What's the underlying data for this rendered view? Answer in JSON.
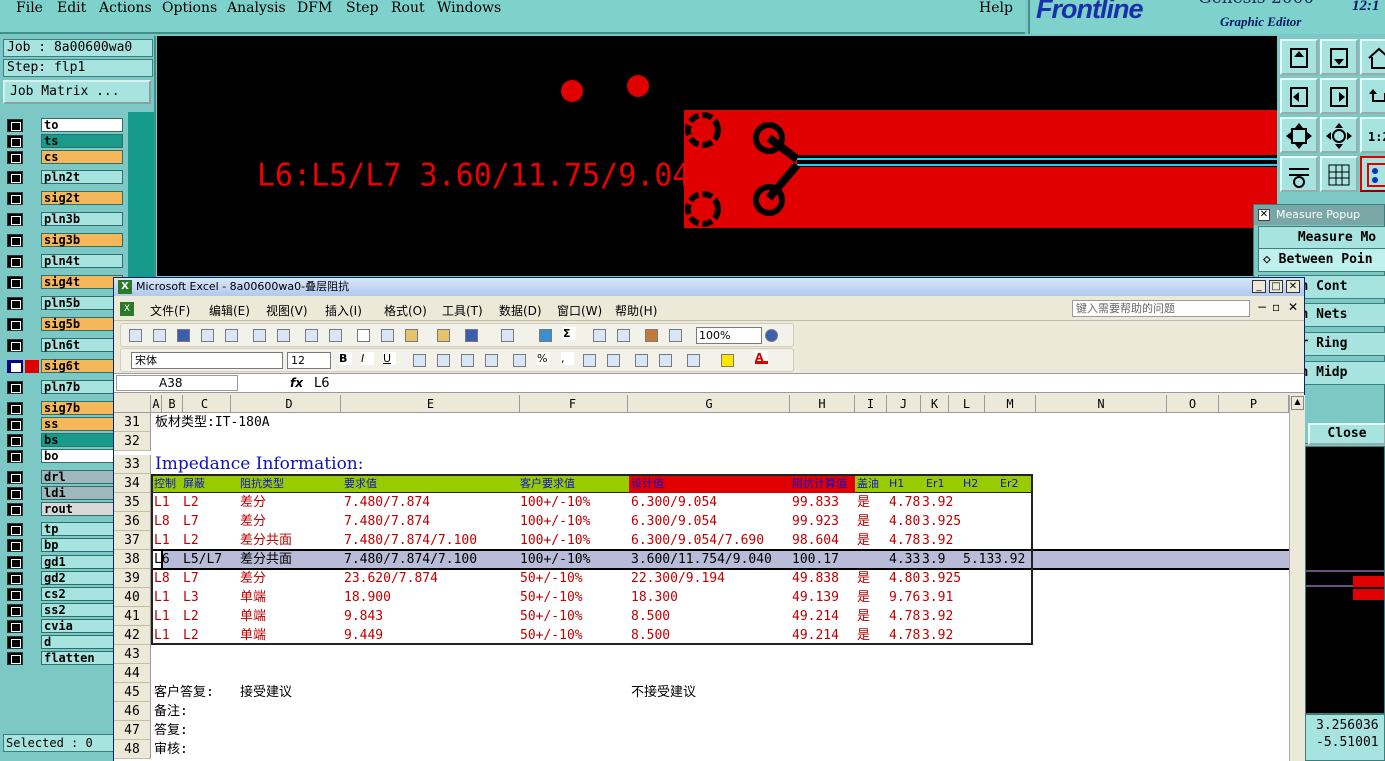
{
  "menubar": {
    "items": [
      "File",
      "Edit",
      "Actions",
      "Options",
      "Analysis",
      "DFM",
      "Step",
      "Rout",
      "Windows"
    ],
    "help": "Help"
  },
  "brand": {
    "logo": "Frontline",
    "product": "Genesis 2000",
    "subtitle": "Graphic Editor",
    "clock": "12:1"
  },
  "left": {
    "job": "Job : 8a00600wa0",
    "step": "Step: flp1",
    "job_matrix": "Job Matrix ...",
    "selected": "Selected : 0",
    "layers": [
      {
        "name": "to",
        "color": "#ffffff",
        "swatch": ""
      },
      {
        "name": "ts",
        "color": "#1a9a8a",
        "swatch": ""
      },
      {
        "name": "cs",
        "color": "#f4b85a",
        "swatch": ""
      },
      {
        "name": "pln2t",
        "color": "#a7e3df",
        "swatch": ""
      },
      {
        "name": "sig2t",
        "color": "#f4b85a",
        "swatch": ""
      },
      {
        "name": "pln3b",
        "color": "#a7e3df",
        "swatch": ""
      },
      {
        "name": "sig3b",
        "color": "#f4b85a",
        "swatch": ""
      },
      {
        "name": "pln4t",
        "color": "#a7e3df",
        "swatch": ""
      },
      {
        "name": "sig4t",
        "color": "#f4b85a",
        "swatch": ""
      },
      {
        "name": "pln5b",
        "color": "#a7e3df",
        "swatch": ""
      },
      {
        "name": "sig5b",
        "color": "#f4b85a",
        "swatch": ""
      },
      {
        "name": "pln6t",
        "color": "#a7e3df",
        "swatch": ""
      },
      {
        "name": "sig6t",
        "color": "#f4b85a",
        "swatch": "#e00000",
        "selected": true
      },
      {
        "name": "pln7b",
        "color": "#a7e3df",
        "swatch": ""
      },
      {
        "name": "sig7b",
        "color": "#f4b85a",
        "swatch": ""
      },
      {
        "name": "ss",
        "color": "#f4b85a",
        "swatch": ""
      },
      {
        "name": "bs",
        "color": "#1a9a8a",
        "swatch": ""
      },
      {
        "name": "bo",
        "color": "#ffffff",
        "swatch": ""
      },
      {
        "name": "drl",
        "color": "#9fb8bc",
        "swatch": ""
      },
      {
        "name": "ldi",
        "color": "#9fb8bc",
        "swatch": ""
      },
      {
        "name": "rout",
        "color": "#d8d8d8",
        "swatch": ""
      },
      {
        "name": "tp",
        "color": "#a7e3df",
        "swatch": ""
      },
      {
        "name": "bp",
        "color": "#a7e3df",
        "swatch": ""
      },
      {
        "name": "gd1",
        "color": "#a7e3df",
        "swatch": ""
      },
      {
        "name": "gd2",
        "color": "#a7e3df",
        "swatch": ""
      },
      {
        "name": "cs2",
        "color": "#a7e3df",
        "swatch": ""
      },
      {
        "name": "ss2",
        "color": "#a7e3df",
        "swatch": ""
      },
      {
        "name": "cvia",
        "color": "#a7e3df",
        "swatch": ""
      },
      {
        "name": "d",
        "color": "#a7e3df",
        "swatch": ""
      },
      {
        "name": "flatten",
        "color": "#a7e3df",
        "swatch": ""
      }
    ]
  },
  "canvas": {
    "label": "L6:L5/L7 3.60/11.75/9.04"
  },
  "measure": {
    "title": "Measure Popup",
    "mode": "Measure Mo",
    "options": [
      "Between Poin",
      "ween Cont",
      "ween Nets",
      "ular Ring",
      "ween Midp"
    ],
    "close": "Close",
    "coords": [
      "3.256036",
      "-5.51001"
    ]
  },
  "excel": {
    "title": "Microsoft Excel - 8a00600wa0-叠层阻抗",
    "menu": [
      "文件(F)",
      "编辑(E)",
      "视图(V)",
      "插入(I)",
      "格式(O)",
      "工具(T)",
      "数据(D)",
      "窗口(W)",
      "帮助(H)"
    ],
    "help_placeholder": "键入需要帮助的问题",
    "font": "宋体",
    "size": "12",
    "zoom": "100%",
    "namebox": "A38",
    "fx": "fx",
    "formula": "L6",
    "columns": [
      "A",
      "B",
      "C",
      "D",
      "E",
      "F",
      "G",
      "H",
      "I",
      "J",
      "K",
      "L",
      "M",
      "N",
      "O",
      "P"
    ],
    "row31": "板材类型:IT-180A",
    "heading": "Impedance Information:",
    "headers": {
      "a": "控制",
      "b": "屏蔽",
      "c": "阻抗类型",
      "d": "要求值",
      "e": "客户要求值",
      "f": "设计值",
      "g": "阻抗计算值",
      "h": "盖油",
      "i": "H1",
      "j": "Er1",
      "k": "H2",
      "l": "Er2"
    },
    "rows": [
      {
        "n": "35",
        "a": "L1",
        "b": "L2",
        "c": "差分",
        "d": "7.480/7.874",
        "e": "100+/-10%",
        "f": "6.300/9.054",
        "g": "99.833",
        "h": "是",
        "i": "4.78",
        "j": "3.92",
        "k": "",
        "l": ""
      },
      {
        "n": "36",
        "a": "L8",
        "b": "L7",
        "c": "差分",
        "d": "7.480/7.874",
        "e": "100+/-10%",
        "f": "6.300/9.054",
        "g": "99.923",
        "h": "是",
        "i": "4.80",
        "j": "3.925",
        "k": "",
        "l": ""
      },
      {
        "n": "37",
        "a": "L1",
        "b": "L2",
        "c": "差分共面",
        "d": "7.480/7.874/7.100",
        "e": "100+/-10%",
        "f": "6.300/9.054/7.690",
        "g": "98.604",
        "h": "是",
        "i": "4.78",
        "j": "3.92",
        "k": "",
        "l": ""
      },
      {
        "n": "38",
        "a": "L6",
        "b": "L5/L7",
        "c": "差分共面",
        "d": "7.480/7.874/7.100",
        "e": "100+/-10%",
        "f": "3.600/11.754/9.040",
        "g": "100.17",
        "h": "",
        "i": "4.33",
        "j": "3.9",
        "k": "5.13",
        "l": "3.92",
        "sel": true
      },
      {
        "n": "39",
        "a": "L8",
        "b": "L7",
        "c": "差分",
        "d": "23.620/7.874",
        "e": "50+/-10%",
        "f": "22.300/9.194",
        "g": "49.838",
        "h": "是",
        "i": "4.80",
        "j": "3.925",
        "k": "",
        "l": ""
      },
      {
        "n": "40",
        "a": "L1",
        "b": "L3",
        "c": "单端",
        "d": "18.900",
        "e": "50+/-10%",
        "f": "18.300",
        "g": "49.139",
        "h": "是",
        "i": "9.76",
        "j": "3.91",
        "k": "",
        "l": ""
      },
      {
        "n": "41",
        "a": "L1",
        "b": "L2",
        "c": "单端",
        "d": "9.843",
        "e": "50+/-10%",
        "f": "8.500",
        "g": "49.214",
        "h": "是",
        "i": "4.78",
        "j": "3.92",
        "k": "",
        "l": ""
      },
      {
        "n": "42",
        "a": "L1",
        "b": "L2",
        "c": "单端",
        "d": "9.449",
        "e": "50+/-10%",
        "f": "8.500",
        "g": "49.214",
        "h": "是",
        "i": "4.78",
        "j": "3.92",
        "k": "",
        "l": ""
      }
    ],
    "row45": {
      "a": "客户答复:",
      "c": "接受建议",
      "f": "不接受建议"
    },
    "row46": "备注:",
    "row47": "答复:",
    "row48": "审核:"
  },
  "colors": {
    "accent_red": "#e00000",
    "header_green": "#99cc00",
    "panel_teal": "#7cc8c4"
  }
}
